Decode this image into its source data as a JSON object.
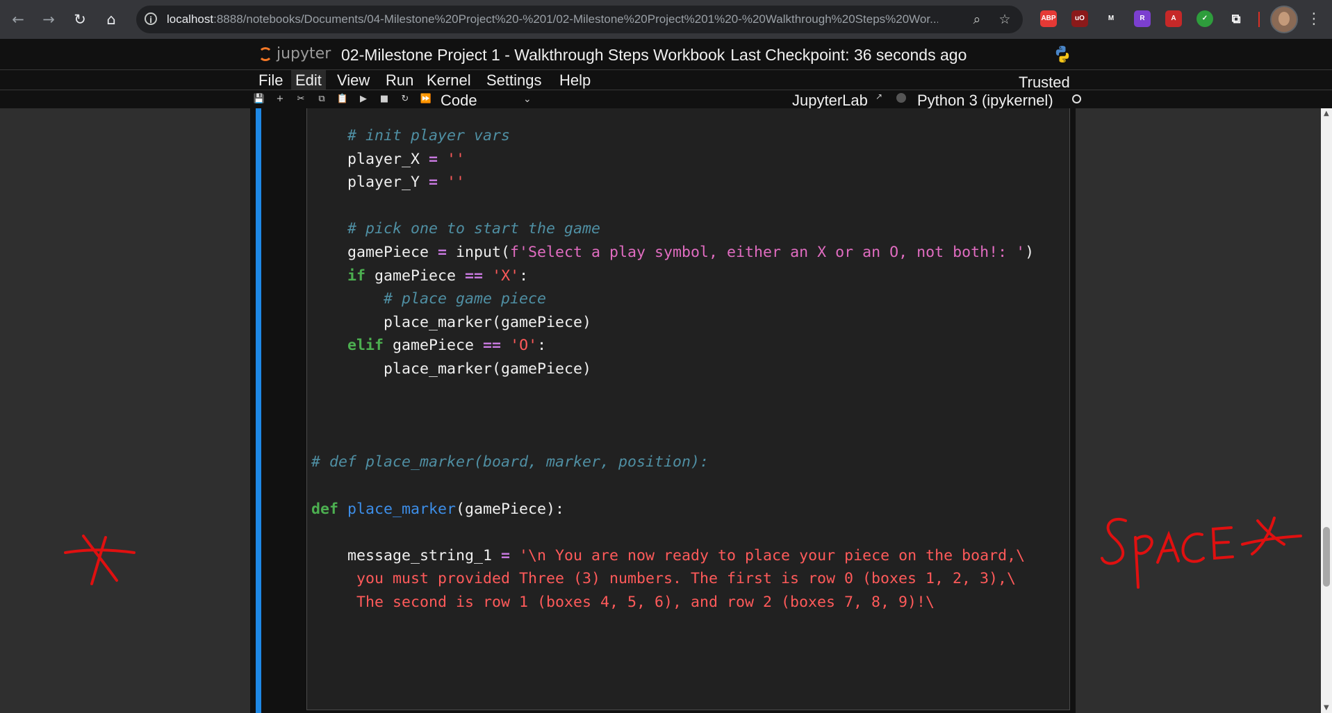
{
  "browser": {
    "url_host": "localhost",
    "url_rest": ":8888/notebooks/Documents/04-Milestone%20Project%20-%201/02-Milestone%20Project%201%20-%20Walkthrough%20Steps%20Wor...",
    "nav": {
      "back": "←",
      "forward": "→",
      "reload": "↻",
      "home": "⌂"
    },
    "info_glyph": "i",
    "zoom_glyph": "⌕",
    "star_glyph": "☆",
    "menu_glyph": "⋮",
    "extensions": [
      {
        "name": "adblock-plus",
        "label": "ABP",
        "color": "#e53935"
      },
      {
        "name": "ublock-origin",
        "label": "uO",
        "color": "#8b1a1a"
      },
      {
        "name": "malwarebytes",
        "label": "M",
        "color": "#35363a"
      },
      {
        "name": "r-extension",
        "label": "R",
        "color": "#7b3fcf"
      },
      {
        "name": "adobe-acrobat",
        "label": "A",
        "color": "#c62828"
      },
      {
        "name": "check-extension",
        "label": "✓",
        "color": "#2e9d3c"
      },
      {
        "name": "puzzle",
        "label": "⧉",
        "color": "#35363a"
      }
    ]
  },
  "jupyter": {
    "logo_text": "jupyter",
    "notebook_title": "02-Milestone Project 1 - Walkthrough Steps Workbook",
    "checkpoint": "Last Checkpoint: 36 seconds ago",
    "trusted": "Trusted",
    "menu": [
      "File",
      "Edit",
      "View",
      "Run",
      "Kernel",
      "Settings",
      "Help"
    ],
    "active_menu": "Edit",
    "toolbar_glyphs": [
      "💾",
      "+",
      "✂",
      "⧉",
      "📋",
      "▶",
      "■",
      "↻",
      "⏩"
    ],
    "cell_type": "Code",
    "jupyterlab_link": "JupyterLab",
    "kernel": "Python 3 (ipykernel)",
    "colors": {
      "active_cell_bar": "#1e88e5",
      "logo_orange": "#f37726"
    }
  },
  "code_lines": [
    [
      {
        "t": "    "
      },
      {
        "t": "# init player vars",
        "c": "cm"
      }
    ],
    [
      {
        "t": "    player_X "
      },
      {
        "t": "=",
        "c": "op"
      },
      {
        "t": " "
      },
      {
        "t": "''",
        "c": "st"
      }
    ],
    [
      {
        "t": "    player_Y "
      },
      {
        "t": "=",
        "c": "op"
      },
      {
        "t": " "
      },
      {
        "t": "''",
        "c": "st"
      }
    ],
    [
      {
        "t": ""
      }
    ],
    [
      {
        "t": "    "
      },
      {
        "t": "# pick one to start the game",
        "c": "cm"
      }
    ],
    [
      {
        "t": "    gamePiece "
      },
      {
        "t": "=",
        "c": "op"
      },
      {
        "t": " input("
      },
      {
        "t": "f'Select a play symbol, either an X or an O, not both!: '",
        "c": "fs"
      },
      {
        "t": ")"
      }
    ],
    [
      {
        "t": "    "
      },
      {
        "t": "if",
        "c": "kw"
      },
      {
        "t": " gamePiece "
      },
      {
        "t": "==",
        "c": "op"
      },
      {
        "t": " "
      },
      {
        "t": "'X'",
        "c": "st"
      },
      {
        "t": ":"
      }
    ],
    [
      {
        "t": "        "
      },
      {
        "t": "# place game piece",
        "c": "cm"
      }
    ],
    [
      {
        "t": "        place_marker(gamePiece)"
      }
    ],
    [
      {
        "t": "    "
      },
      {
        "t": "elif",
        "c": "kw"
      },
      {
        "t": " gamePiece "
      },
      {
        "t": "==",
        "c": "op"
      },
      {
        "t": " "
      },
      {
        "t": "'O'",
        "c": "st"
      },
      {
        "t": ":"
      }
    ],
    [
      {
        "t": "        place_marker(gamePiece)"
      }
    ],
    [
      {
        "t": ""
      }
    ],
    [
      {
        "t": ""
      }
    ],
    [
      {
        "t": ""
      }
    ],
    [
      {
        "t": "# def place_marker(board, marker, position):",
        "c": "cm"
      }
    ],
    [
      {
        "t": ""
      }
    ],
    [
      {
        "t": "def",
        "c": "kw"
      },
      {
        "t": " "
      },
      {
        "t": "place_marker",
        "c": "fn"
      },
      {
        "t": "(gamePiece):"
      }
    ],
    [
      {
        "t": ""
      }
    ],
    [
      {
        "t": "    message_string_1 "
      },
      {
        "t": "=",
        "c": "op"
      },
      {
        "t": " "
      },
      {
        "t": "'\\n You are now ready to place your piece on the board,\\",
        "c": "st"
      }
    ],
    [
      {
        "t": "     you must provided Three (3) numbers. The first is row 0 (boxes 1, 2, 3),\\",
        "c": "st"
      }
    ],
    [
      {
        "t": "     The second is row 1 (boxes 4, 5, 6), and row 2 (boxes 7, 8, 9)!\\",
        "c": "st"
      }
    ]
  ],
  "annotations": {
    "left_symbol": "*",
    "right_text": "SPACE *",
    "color": "#e01010"
  }
}
